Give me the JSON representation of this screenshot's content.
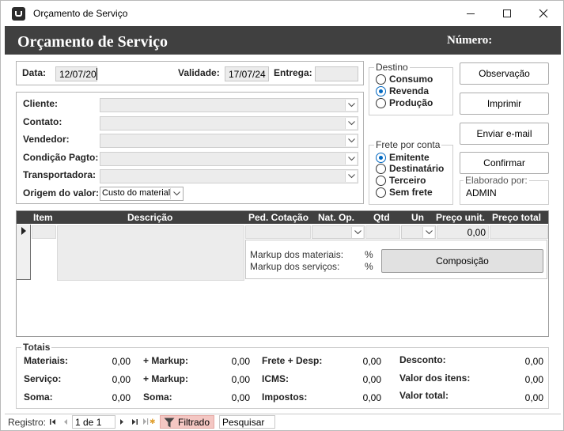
{
  "window": {
    "title": "Orçamento de Serviço"
  },
  "header": {
    "title": "Orçamento de Serviço",
    "number_label": "Número:"
  },
  "dates": {
    "data_label": "Data:",
    "data_value": "12/07/20",
    "validade_label": "Validade:",
    "validade_value": "17/07/24",
    "entrega_label": "Entrega:",
    "entrega_value": ""
  },
  "form": {
    "cliente_label": "Cliente:",
    "contato_label": "Contato:",
    "vendedor_label": "Vendedor:",
    "condicao_label": "Condição Pagto:",
    "transportadora_label": "Transportadora:",
    "origem_label": "Origem do valor:",
    "origem_value": "Custo do material"
  },
  "destino": {
    "title": "Destino",
    "options": [
      "Consumo",
      "Revenda",
      "Produção"
    ],
    "selected": "Revenda"
  },
  "frete": {
    "title": "Frete por conta",
    "options": [
      "Emitente",
      "Destinatário",
      "Terceiro",
      "Sem frete"
    ],
    "selected": "Emitente"
  },
  "buttons": {
    "observacao": "Observação",
    "imprimir": "Imprimir",
    "enviar": "Enviar e-mail",
    "confirmar": "Confirmar"
  },
  "elaborado": {
    "label": "Elaborado por:",
    "value": "ADMIN"
  },
  "grid": {
    "columns": [
      "Item",
      "Descrição",
      "Ped. Cotação",
      "Nat. Op.",
      "Qtd",
      "Un",
      "Preço unit.",
      "Preço total"
    ],
    "row_preco_unit": "0,00",
    "markup_materiais_label": "Markup dos materiais:",
    "markup_servicos_label": "Markup dos serviços:",
    "percent": "%",
    "composicao_button": "Composição"
  },
  "totais": {
    "title": "Totais",
    "materiais_label": "Materiais:",
    "materiais_value": "0,00",
    "servico_label": "Serviço:",
    "servico_value": "0,00",
    "soma1_label": "Soma:",
    "soma1_value": "0,00",
    "markup1_label": "+ Markup:",
    "markup1_value": "0,00",
    "markup2_label": "+ Markup:",
    "markup2_value": "0,00",
    "soma2_label": "Soma:",
    "soma2_value": "0,00",
    "frete_label": "Frete + Desp:",
    "frete_value": "0,00",
    "icms_label": "ICMS:",
    "icms_value": "0,00",
    "impostos_label": "Impostos:",
    "impostos_value": "0,00",
    "desconto_label": "Desconto:",
    "desconto_value": "0,00",
    "valor_itens_label": "Valor dos itens:",
    "valor_itens_value": "0,00",
    "valor_total_label": "Valor total:",
    "valor_total_value": "0,00"
  },
  "statusbar": {
    "registro_label": "Registro:",
    "record_position": "1 de 1",
    "filter_label": "Filtrado",
    "search_placeholder": "Pesquisar"
  },
  "colors": {
    "header_bg": "#404040",
    "radio_accent": "#0067c0",
    "filter_bg": "#f4c7c3"
  }
}
